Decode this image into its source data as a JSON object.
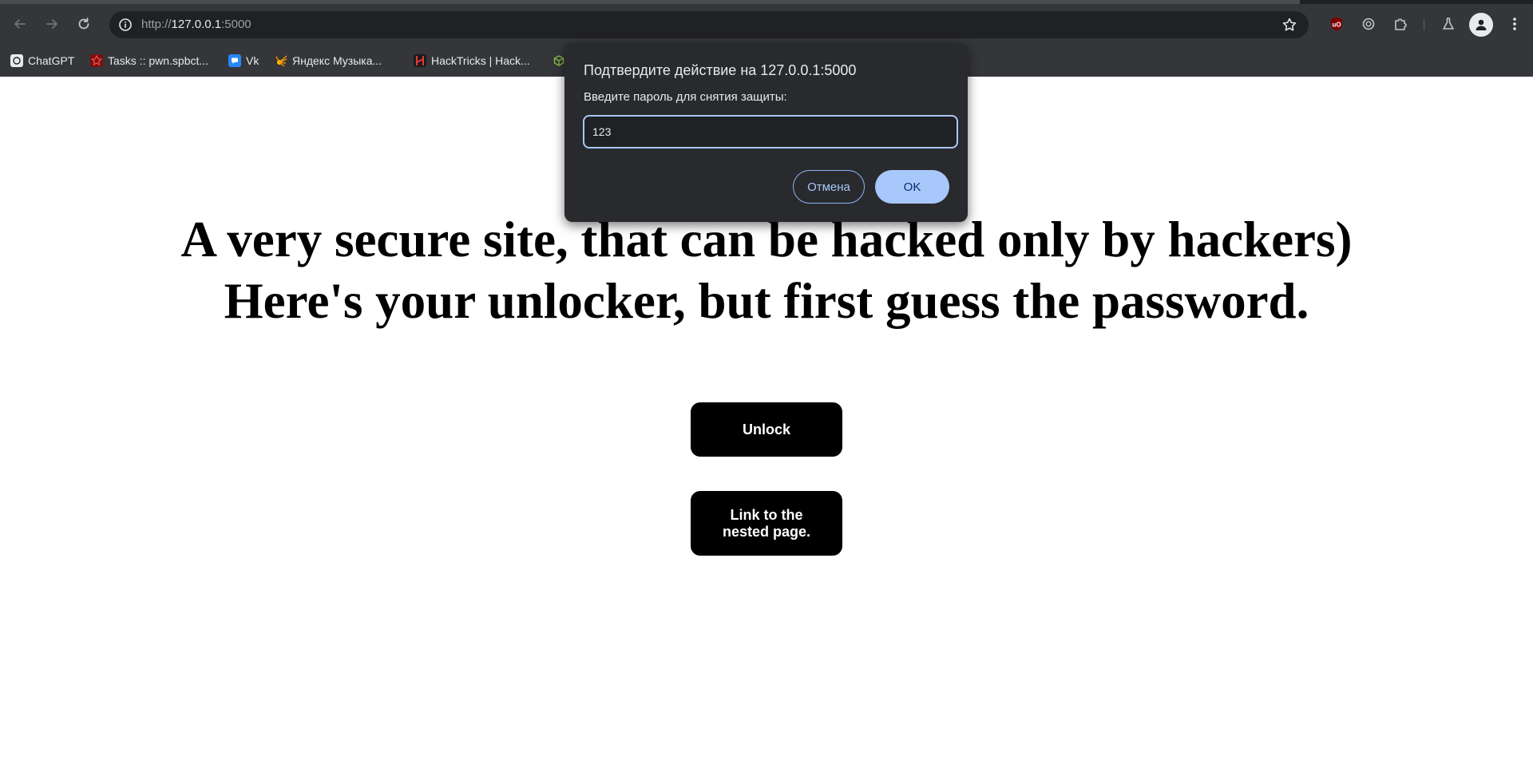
{
  "browser": {
    "url_scheme": "http://",
    "url_host": "127.0.0.1",
    "url_port": ":5000",
    "bookmarks": [
      {
        "label": "ChatGPT",
        "icon": "chatgpt-icon"
      },
      {
        "label": "Tasks :: pwn.spbct...",
        "icon": "star-icon"
      },
      {
        "label": "Vk",
        "icon": "chat-bubble-icon"
      },
      {
        "label": "Яндекс Музыка...",
        "icon": "sun-icon"
      },
      {
        "label": "HackTricks | Hack...",
        "icon": "hacktricks-icon"
      }
    ],
    "extensions": [
      "ublock-origin-icon",
      "ai-extension-icon",
      "puzzle-extensions-icon",
      "labs-flask-icon"
    ]
  },
  "page": {
    "headline_line1": "A very secure site, that can be hacked only by hackers)",
    "headline_line2": "Here's your unlocker, but first guess the password.",
    "unlock_label": "Unlock",
    "nested_label": "Link to the nested page."
  },
  "dialog": {
    "title": "Подтвердите действие на 127.0.0.1:5000",
    "message": "Введите пароль для снятия защиты:",
    "input_value": "123",
    "cancel_label": "Отмена",
    "ok_label": "OK"
  },
  "colors": {
    "chrome_bg": "#35363a",
    "dialog_bg": "#292a2d",
    "accent": "#a8c7fa",
    "page_button_bg": "#000000"
  }
}
